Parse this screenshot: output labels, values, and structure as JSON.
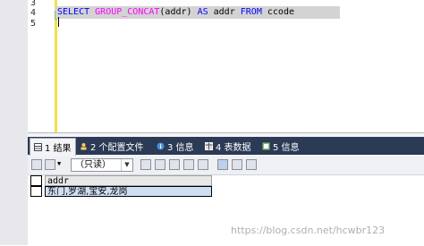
{
  "editor": {
    "line_numbers": [
      "3",
      "4",
      "5"
    ],
    "query": {
      "select": "SELECT",
      "func": "GROUP_CONCAT",
      "arg": "(addr)",
      "as": "AS",
      "alias": "addr",
      "from": "FROM",
      "table": "ccode"
    }
  },
  "result_tabs": [
    {
      "label": "1 结果",
      "icon": "result-grid-icon"
    },
    {
      "label": "2 个配置文件",
      "icon": "profile-icon"
    },
    {
      "label": "3 信息",
      "icon": "info-icon"
    },
    {
      "label": "4 表数据",
      "icon": "table-data-icon"
    },
    {
      "label": "5 信息",
      "icon": "info-icon"
    }
  ],
  "toolbar": {
    "mode_select": "（只读）"
  },
  "grid": {
    "column": "addr",
    "rows": [
      "东门,罗湖,宝安,龙岗"
    ]
  },
  "watermark": "https://blog.csdn.net/hcwbr123"
}
